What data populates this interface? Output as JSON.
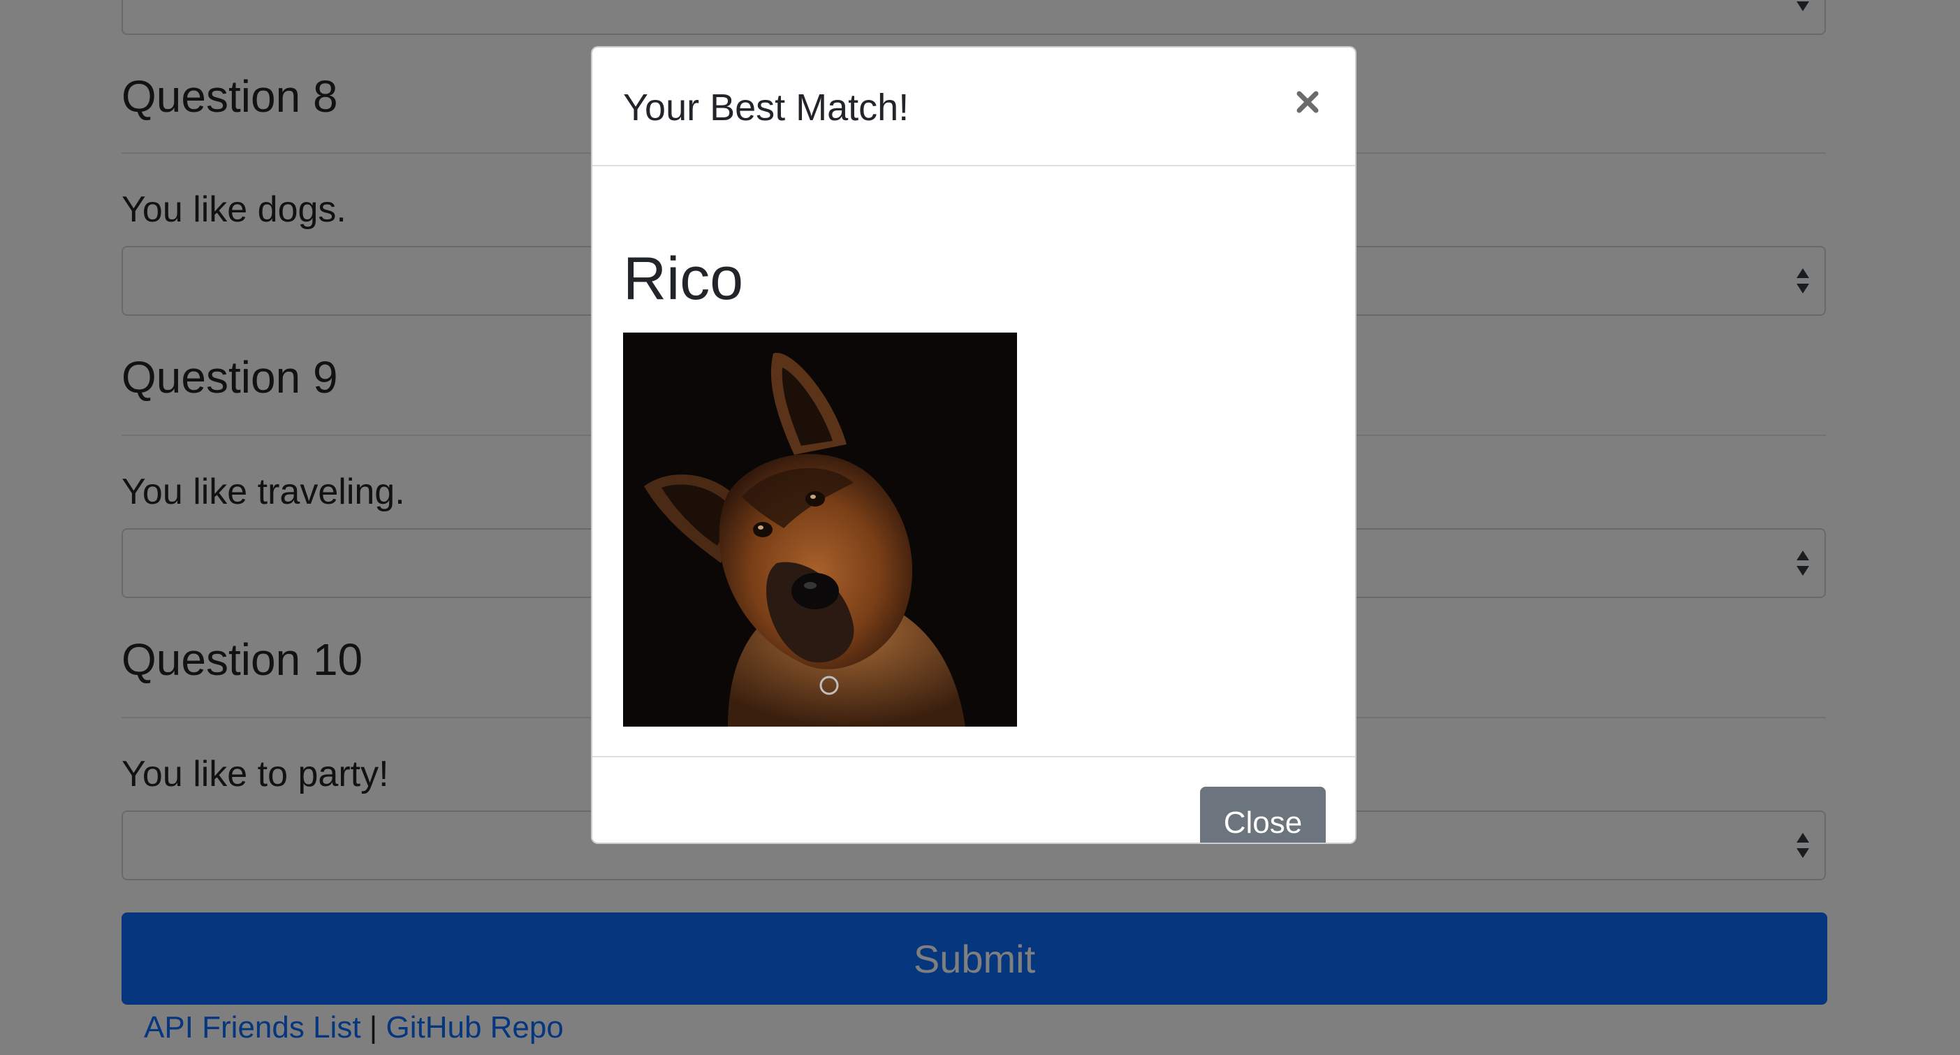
{
  "questions": [
    {
      "heading": "Question 8",
      "text": "You like dogs."
    },
    {
      "heading": "Question 9",
      "text": "You like traveling."
    },
    {
      "heading": "Question 10",
      "text": "You like to party!"
    }
  ],
  "form": {
    "submit_label": "Submit"
  },
  "footer": {
    "link_api": "API Friends List",
    "separator": "|",
    "link_repo": "GitHub Repo"
  },
  "modal": {
    "title": "Your Best Match!",
    "match_name": "Rico",
    "photo_subject": "german-shepherd-dog",
    "close_label": "Close"
  },
  "colors": {
    "primary": "#0d6efd",
    "secondary": "#6c757d",
    "backdrop": "rgba(0,0,0,0.5)"
  }
}
